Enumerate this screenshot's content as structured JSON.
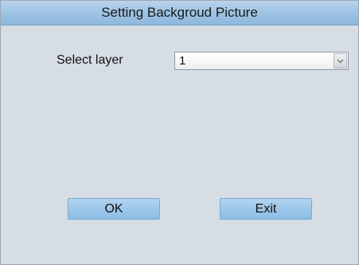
{
  "dialog": {
    "title": "Setting Backgroud Picture"
  },
  "form": {
    "layer_label": "Select layer",
    "layer_value": "1",
    "dropdown_icon": "chevron-down-icon"
  },
  "buttons": {
    "ok_label": "OK",
    "exit_label": "Exit"
  }
}
